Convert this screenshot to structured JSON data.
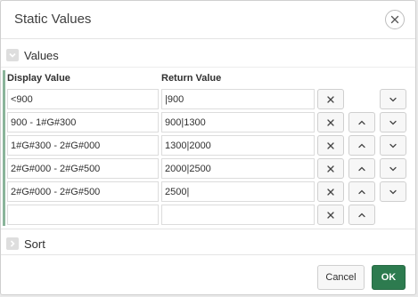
{
  "dialog": {
    "title": "Static Values"
  },
  "sections": {
    "values_label": "Values",
    "sort_label": "Sort"
  },
  "columns": {
    "display": "Display Value",
    "return": "Return Value"
  },
  "rows": [
    {
      "display": "<900",
      "return": "|900",
      "has_up": false,
      "has_down": true
    },
    {
      "display": "900 - 1#G#300",
      "return": "900|1300",
      "has_up": true,
      "has_down": true
    },
    {
      "display": "1#G#300 - 2#G#000",
      "return": "1300|2000",
      "has_up": true,
      "has_down": true
    },
    {
      "display": "2#G#000 - 2#G#500",
      "return": "2000|2500",
      "has_up": true,
      "has_down": true
    },
    {
      "display": "2#G#000 - 2#G#500",
      "return": "2500|",
      "has_up": true,
      "has_down": true
    },
    {
      "display": "",
      "return": "",
      "has_up": true,
      "has_down": false
    }
  ],
  "footer": {
    "cancel_label": "Cancel",
    "ok_label": "OK"
  },
  "icons": {
    "close": "close-icon",
    "remove": "x-icon",
    "up": "chevron-up-icon",
    "down": "chevron-down-icon",
    "section_open": "chevron-down-icon",
    "section_closed": "chevron-right-icon"
  },
  "colors": {
    "primary": "#2d7b4f",
    "accent": "#8ab59a"
  }
}
